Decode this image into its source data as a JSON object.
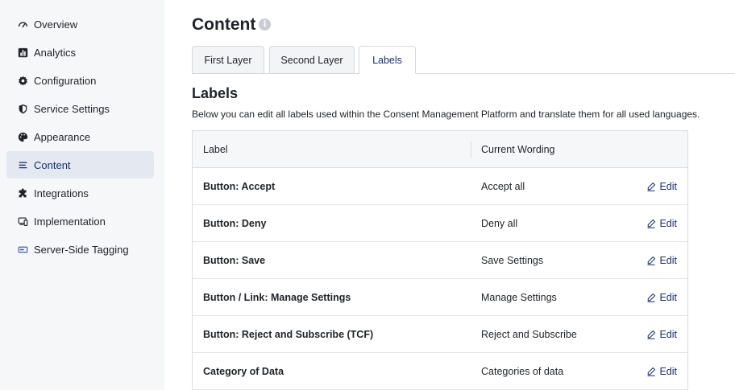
{
  "sidebar": {
    "items": [
      {
        "label": "Overview",
        "icon": "gauge-icon"
      },
      {
        "label": "Analytics",
        "icon": "bar-chart-icon"
      },
      {
        "label": "Configuration",
        "icon": "gear-icon"
      },
      {
        "label": "Service Settings",
        "icon": "shield-icon"
      },
      {
        "label": "Appearance",
        "icon": "palette-icon"
      },
      {
        "label": "Content",
        "icon": "text-lines-icon"
      },
      {
        "label": "Integrations",
        "icon": "puzzle-icon"
      },
      {
        "label": "Implementation",
        "icon": "devices-icon"
      },
      {
        "label": "Server-Side Tagging",
        "icon": "server-icon"
      }
    ],
    "active": "Content"
  },
  "header": {
    "title": "Content",
    "info_glyph": "i"
  },
  "tabs": [
    {
      "label": "First Layer"
    },
    {
      "label": "Second Layer"
    },
    {
      "label": "Labels"
    }
  ],
  "section": {
    "title": "Labels",
    "description": "Below you can edit all labels used within the Consent Management Platform and translate them for all used languages."
  },
  "table": {
    "columns": [
      "Label",
      "Current Wording"
    ],
    "edit_label": "Edit",
    "rows": [
      {
        "label": "Button: Accept",
        "wording": "Accept all"
      },
      {
        "label": "Button: Deny",
        "wording": "Deny all"
      },
      {
        "label": "Button: Save",
        "wording": "Save Settings"
      },
      {
        "label": "Button / Link: Manage Settings",
        "wording": "Manage Settings"
      },
      {
        "label": "Button: Reject and Subscribe (TCF)",
        "wording": "Reject and Subscribe"
      },
      {
        "label": "Category of Data",
        "wording": "Categories of data"
      }
    ]
  },
  "colors": {
    "accent": "#1c2f6f",
    "sidebar_bg": "#f6f7f9",
    "active_bg": "#e3e8f1"
  }
}
